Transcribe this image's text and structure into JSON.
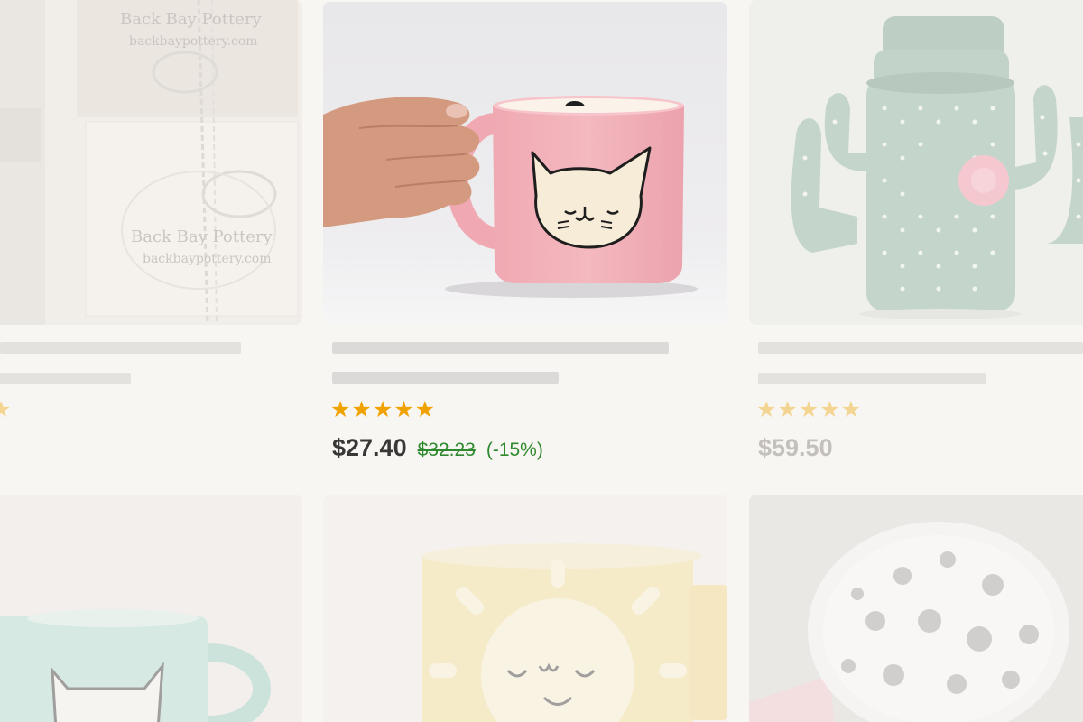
{
  "listings": {
    "left_top": {
      "image_alt": "Back Bay Pottery gift packaging",
      "brand_text_1": "Back Bay Pottery",
      "brand_url_1": "backbaypottery.com",
      "brand_text_2": "Back Bay Pottery",
      "brand_url_2": "backbaypottery.com",
      "rating_stars": "★"
    },
    "center_top": {
      "image_alt": "Pink cat mug held by a hand",
      "rating_stars": "★★★★★",
      "price": "$27.40",
      "original_price": "$32.23",
      "discount": "(-15%)"
    },
    "right_top": {
      "image_alt": "Green cactus shaped ceramic mugs",
      "rating_stars": "★★★★★",
      "price": "$59.50"
    },
    "left_bottom": {
      "image_alt": "Mint green cat mug"
    },
    "center_bottom": {
      "image_alt": "Yellow sun face mug"
    },
    "right_bottom": {
      "image_alt": "White polka dot mug interior"
    }
  },
  "colors": {
    "star": "#f0a300",
    "discount_green": "#2f8a2f",
    "price": "#3a3836",
    "background": "#f8f6f3"
  }
}
